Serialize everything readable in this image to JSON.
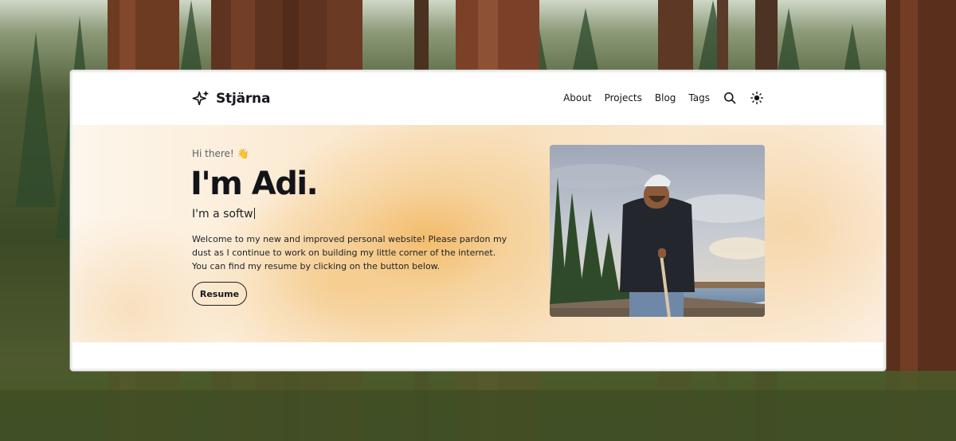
{
  "brand": {
    "name": "Stjärna",
    "icon": "sparkle-star-icon"
  },
  "nav": {
    "links": [
      "About",
      "Projects",
      "Blog",
      "Tags"
    ],
    "search_icon": "search-icon",
    "theme_icon": "sun-icon"
  },
  "hero": {
    "greeting": "Hi there! 👋",
    "headline": "I'm Adi.",
    "typed_text": "I'm a softw",
    "intro": "Welcome to my new and improved personal website! Please pardon my dust as I continue to work on building my little corner of the internet. You can find my resume by clicking on the button below.",
    "resume_label": "Resume"
  },
  "colors": {
    "text": "#15171c",
    "hero_accent": "#f1b65e",
    "window_bg": "#ffffff"
  }
}
